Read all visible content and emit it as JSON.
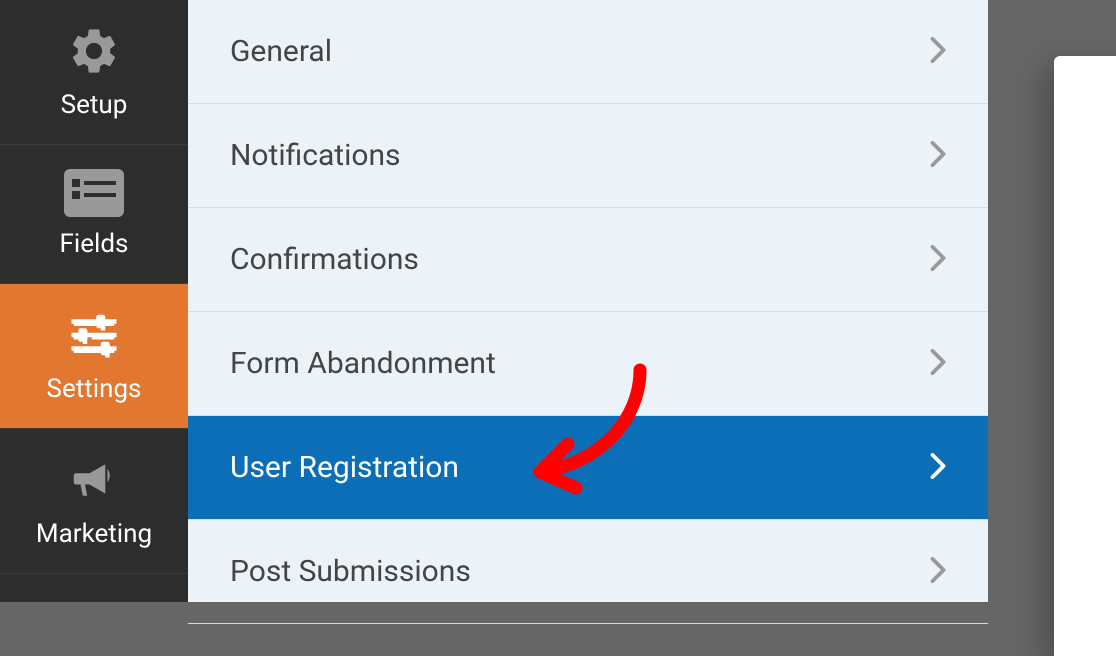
{
  "sidebar": {
    "items": [
      {
        "label": "Setup"
      },
      {
        "label": "Fields"
      },
      {
        "label": "Settings"
      },
      {
        "label": "Marketing"
      }
    ]
  },
  "settings": {
    "items": [
      {
        "label": "General"
      },
      {
        "label": "Notifications"
      },
      {
        "label": "Confirmations"
      },
      {
        "label": "Form Abandonment"
      },
      {
        "label": "User Registration"
      },
      {
        "label": "Post Submissions"
      }
    ]
  }
}
